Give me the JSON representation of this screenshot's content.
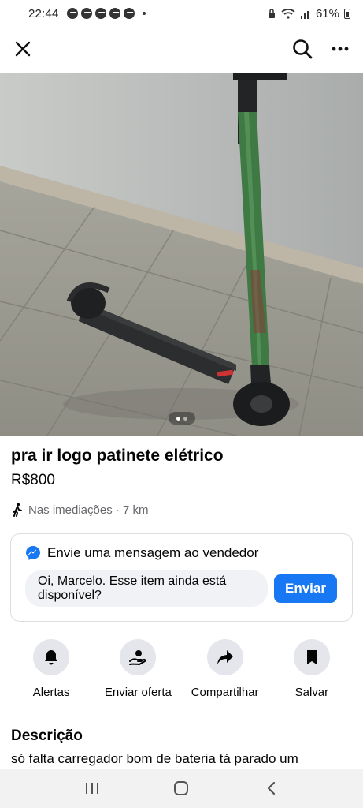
{
  "status_bar": {
    "time": "22:44",
    "battery_text": "61%"
  },
  "header": {
    "close_icon": "close-icon",
    "search_icon": "search-icon",
    "more_icon": "more-icon"
  },
  "photo": {
    "pager_total": 2,
    "pager_active": 1
  },
  "listing": {
    "title": "pra ir logo patinete elétrico",
    "price": "R$800",
    "location": "Nas imediações · 7 km"
  },
  "message": {
    "heading": "Envie uma mensagem ao vendedor",
    "input_value": "Oi, Marcelo. Esse item ainda está disponível?",
    "send_label": "Enviar"
  },
  "actions": [
    {
      "label": "Alertas",
      "icon": "bell-icon"
    },
    {
      "label": "Enviar oferta",
      "icon": "offer-icon"
    },
    {
      "label": "Compartilhar",
      "icon": "share-icon"
    },
    {
      "label": "Salvar",
      "icon": "bookmark-icon"
    }
  ],
  "description": {
    "heading": "Descrição",
    "text": "só falta carregador bom de bateria tá parado um"
  },
  "colors": {
    "accent": "#1877f2",
    "text": "#050505",
    "muted": "#65676b",
    "chip_bg": "#e4e6eb"
  }
}
